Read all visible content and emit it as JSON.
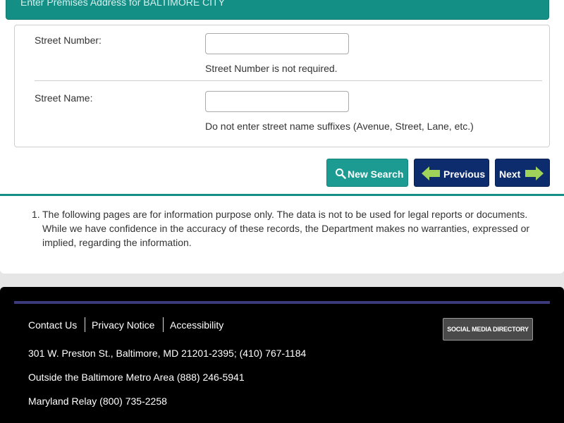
{
  "header": {
    "title": "Enter Premises Address for BALTIMORE CITY"
  },
  "form": {
    "street_number": {
      "label": "Street Number:",
      "value": "",
      "hint": "Street Number is not required."
    },
    "street_name": {
      "label": "Street Name:",
      "value": "",
      "hint": "Do not enter street name suffixes (Avenue, Street, Lane, etc.)"
    }
  },
  "buttons": {
    "new_search": "New Search",
    "previous": "Previous",
    "next": "Next"
  },
  "notes": [
    {
      "number": "1.",
      "text": "The following pages are for information purpose only. The data is not to be used for legal reports or documents. While we have confidence in the accuracy of these records, the Department makes no warranties, expressed or implied, regarding the information."
    }
  ],
  "footer": {
    "links": [
      "Contact Us",
      "Privacy Notice",
      "Accessibility"
    ],
    "address": "301 W. Preston St., Baltimore, MD 21201-2395; (410) 767-1184",
    "outside": "Outside the Baltimore Metro Area (888) 246-5941",
    "relay": "Maryland Relay (800) 735-2258",
    "social": "SOCIAL MEDIA DIRECTORY"
  },
  "colors": {
    "teal": "#138f86",
    "navy": "#0d2c6e",
    "arrow": "#9fd35a"
  },
  "icons": {
    "new_search": "search-icon",
    "previous": "arrow-left-icon",
    "next": "arrow-right-icon"
  }
}
